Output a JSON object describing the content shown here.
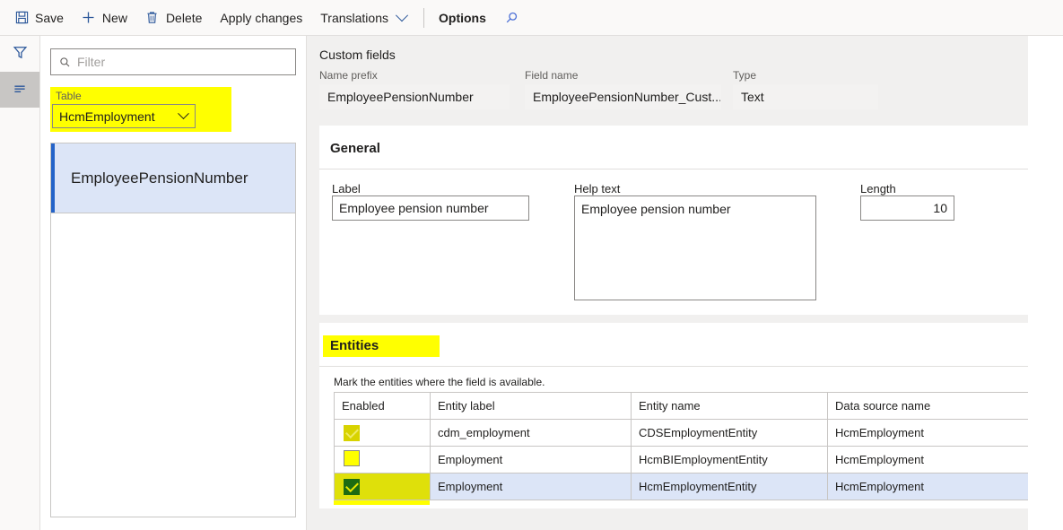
{
  "toolbar": {
    "save_label": "Save",
    "new_label": "New",
    "delete_label": "Delete",
    "apply_changes_label": "Apply changes",
    "translations_label": "Translations",
    "options_label": "Options",
    "search_icon_name": "search-icon"
  },
  "rail": {
    "filter_icon_name": "filter-icon",
    "list_icon_name": "list-lines-icon"
  },
  "left_pane": {
    "filter_placeholder": "Filter",
    "table_label": "Table",
    "table_value": "HcmEmployment",
    "items": [
      {
        "label": "EmployeePensionNumber",
        "selected": true
      }
    ]
  },
  "main": {
    "page_title": "Custom fields",
    "top_fields": {
      "name_prefix_label": "Name prefix",
      "name_prefix_value": "EmployeePensionNumber",
      "field_name_label": "Field name",
      "field_name_value": "EmployeePensionNumber_Cust...",
      "type_label": "Type",
      "type_value": "Text"
    },
    "general": {
      "header": "General",
      "label_caption": "Label",
      "label_value": "Employee pension number",
      "help_caption": "Help text",
      "help_value": "Employee pension number",
      "length_caption": "Length",
      "length_value": "10"
    },
    "entities": {
      "header": "Entities",
      "note": "Mark the entities where the field is available.",
      "columns": [
        "Enabled",
        "Entity label",
        "Entity name",
        "Data source name"
      ],
      "rows": [
        {
          "enabled_state": "disabled-checked",
          "entity_label": "cdm_employment",
          "entity_name": "CDSEmploymentEntity",
          "data_source_name": "HcmEmployment",
          "selected": false
        },
        {
          "enabled_state": "empty",
          "entity_label": "Employment",
          "entity_name": "HcmBIEmploymentEntity",
          "data_source_name": "HcmEmployment",
          "selected": false
        },
        {
          "enabled_state": "checked",
          "entity_label": "Employment",
          "entity_name": "HcmEmploymentEntity",
          "data_source_name": "HcmEmployment",
          "selected": true
        }
      ]
    }
  },
  "colors": {
    "highlight": "#ffff00",
    "accent": "#2b579a",
    "selection": "#dce5f7",
    "checked_green": "#1d6b12"
  }
}
